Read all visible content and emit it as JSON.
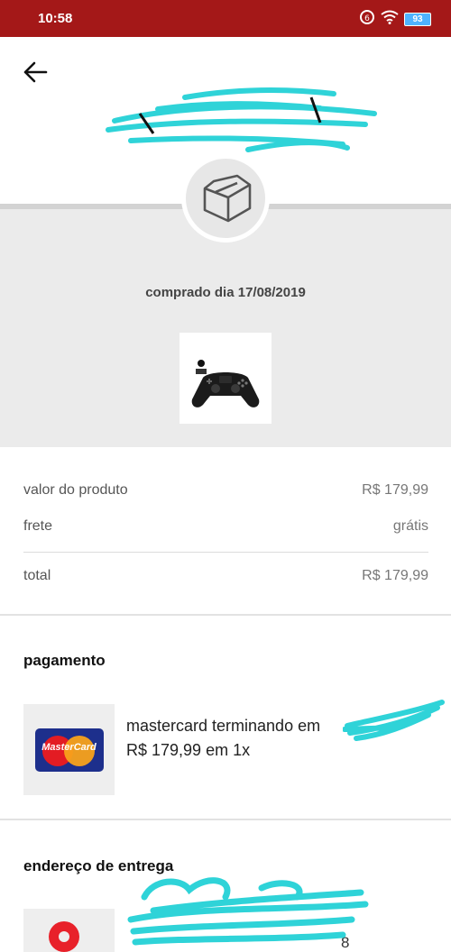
{
  "status_bar": {
    "time": "10:58",
    "battery": "93"
  },
  "header": {
    "back_icon": "arrow-left-icon"
  },
  "purchase": {
    "date_label": "comprado dia 17/08/2019",
    "product_image": "ps4-controller"
  },
  "summary": {
    "rows": [
      {
        "label": "valor do produto",
        "value": "R$ 179,99"
      },
      {
        "label": "frete",
        "value": "grátis"
      }
    ],
    "total_label": "total",
    "total_value": "R$ 179,99"
  },
  "payment": {
    "title": "pagamento",
    "card_brand": "MasterCard",
    "card_line": "mastercard terminando em",
    "installments": "R$ 179,99 em 1x"
  },
  "delivery": {
    "title": "endereço de entrega",
    "visible_fragment": "8"
  },
  "colors": {
    "status_bar": "#a41818",
    "band": "#ebebeb",
    "scribble": "#2fd3d8"
  }
}
